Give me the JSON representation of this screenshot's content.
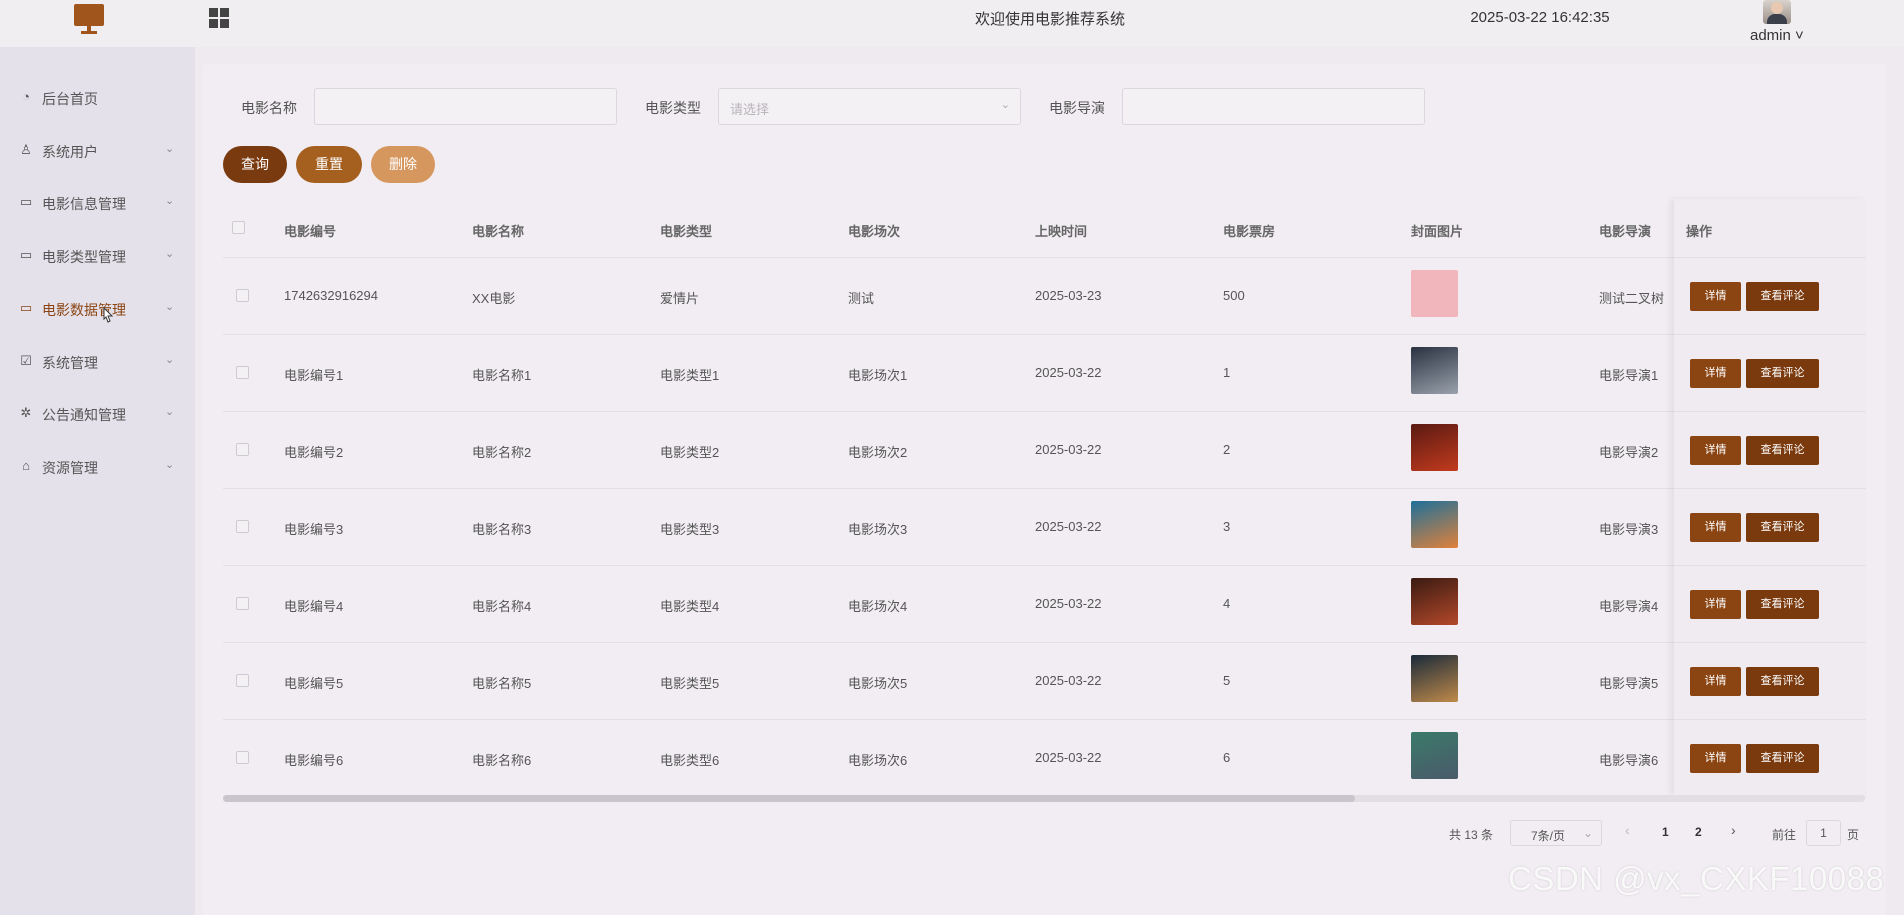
{
  "header": {
    "welcome": "欢迎使用电影推荐系统",
    "datetime": "2025-03-22 16:42:35",
    "username": "admin ˅"
  },
  "sidebar": {
    "items": [
      {
        "label": "后台首页",
        "icon": "pie-chart-icon",
        "glyph": "◔"
      },
      {
        "label": "系统用户",
        "icon": "user-icon",
        "glyph": "♙"
      },
      {
        "label": "电影信息管理",
        "icon": "card-icon",
        "glyph": "▭"
      },
      {
        "label": "电影类型管理",
        "icon": "card-icon",
        "glyph": "▭"
      },
      {
        "label": "电影数据管理",
        "icon": "card-icon",
        "glyph": "▭"
      },
      {
        "label": "系统管理",
        "icon": "chart-icon",
        "glyph": "☑"
      },
      {
        "label": "公告通知管理",
        "icon": "sparkle-icon",
        "glyph": "✲"
      },
      {
        "label": "资源管理",
        "icon": "box-icon",
        "glyph": "⌂"
      }
    ],
    "active_index": 4
  },
  "filters": {
    "name_label": "电影名称",
    "name_value": "",
    "type_label": "电影类型",
    "type_placeholder": "请选择",
    "director_label": "电影导演",
    "director_value": ""
  },
  "actions": {
    "query": "查询",
    "reset": "重置",
    "delete": "删除"
  },
  "table": {
    "columns": [
      "电影编号",
      "电影名称",
      "电影类型",
      "电影场次",
      "上映时间",
      "电影票房",
      "封面图片",
      "电影导演",
      "操作"
    ],
    "rows": [
      {
        "id": "1742632916294",
        "name": "XX电影",
        "type": "爱情片",
        "session": "测试",
        "date": "2025-03-23",
        "box": "500",
        "director": "测试二叉树",
        "cover": [
          "#f1b6bb",
          "#f1b6bb"
        ]
      },
      {
        "id": "电影编号1",
        "name": "电影名称1",
        "type": "电影类型1",
        "session": "电影场次1",
        "date": "2025-03-22",
        "box": "1",
        "director": "电影导演1",
        "cover": [
          "#2a3140",
          "#9aa2ad"
        ]
      },
      {
        "id": "电影编号2",
        "name": "电影名称2",
        "type": "电影类型2",
        "session": "电影场次2",
        "date": "2025-03-22",
        "box": "2",
        "director": "电影导演2",
        "cover": [
          "#5a1a12",
          "#c23a1e"
        ]
      },
      {
        "id": "电影编号3",
        "name": "电影名称3",
        "type": "电影类型3",
        "session": "电影场次3",
        "date": "2025-03-22",
        "box": "3",
        "director": "电影导演3",
        "cover": [
          "#1e6f9a",
          "#e0823a"
        ]
      },
      {
        "id": "电影编号4",
        "name": "电影名称4",
        "type": "电影类型4",
        "session": "电影场次4",
        "date": "2025-03-22",
        "box": "4",
        "director": "电影导演4",
        "cover": [
          "#3a1b12",
          "#b4482a"
        ]
      },
      {
        "id": "电影编号5",
        "name": "电影名称5",
        "type": "电影类型5",
        "session": "电影场次5",
        "date": "2025-03-22",
        "box": "5",
        "director": "电影导演5",
        "cover": [
          "#1a2a3a",
          "#c08a4a"
        ]
      },
      {
        "id": "电影编号6",
        "name": "电影名称6",
        "type": "电影类型6",
        "session": "电影场次6",
        "date": "2025-03-22",
        "box": "6",
        "director": "电影导演6",
        "cover": [
          "#3a7a6a",
          "#4a5a6a"
        ]
      }
    ],
    "detail_label": "详情",
    "comments_label": "查看评论"
  },
  "pagination": {
    "total": "共 13 条",
    "page_size": "7条/页",
    "pages": [
      "1",
      "2"
    ],
    "goto_label": "前往",
    "goto_value": "1",
    "page_suffix": "页"
  },
  "colors": {
    "query_btn": "#7a3a10",
    "reset_btn": "#a5601f",
    "delete_btn": "#d6975f",
    "accent": "#8b4513"
  },
  "watermark": "CSDN @vx_CXKF10088"
}
